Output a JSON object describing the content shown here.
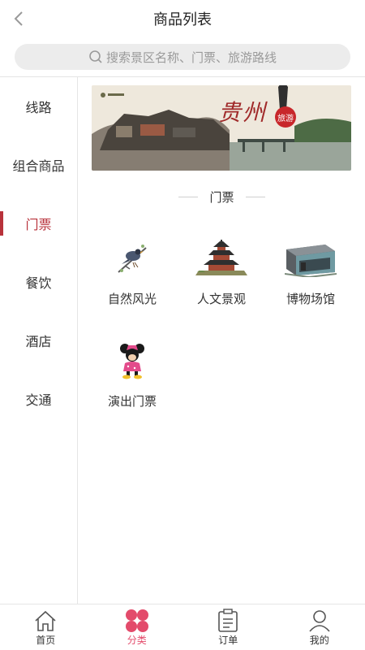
{
  "header": {
    "title": "商品列表"
  },
  "search": {
    "placeholder": "搜索景区名称、门票、旅游路线"
  },
  "sidebar": {
    "items": [
      {
        "label": "线路",
        "active": false
      },
      {
        "label": "组合商品",
        "active": false
      },
      {
        "label": "门票",
        "active": true
      },
      {
        "label": "餐饮",
        "active": false
      },
      {
        "label": "酒店",
        "active": false
      },
      {
        "label": "交通",
        "active": false
      }
    ]
  },
  "banner": {
    "title": "贵州",
    "badge": "旅游"
  },
  "section": {
    "title": "门票"
  },
  "categories": [
    {
      "label": "自然风光",
      "icon": "bird-branch-icon"
    },
    {
      "label": "人文景观",
      "icon": "pagoda-icon"
    },
    {
      "label": "博物场馆",
      "icon": "museum-icon"
    },
    {
      "label": "演出门票",
      "icon": "minnie-icon"
    }
  ],
  "tabbar": {
    "items": [
      {
        "label": "首页",
        "icon": "home-icon",
        "active": false
      },
      {
        "label": "分类",
        "icon": "category-icon",
        "active": true
      },
      {
        "label": "订单",
        "icon": "order-icon",
        "active": false
      },
      {
        "label": "我的",
        "icon": "user-icon",
        "active": false
      }
    ]
  },
  "colors": {
    "accent": "#b8323b",
    "tab_active": "#e34b6b",
    "search_bg": "#ececec"
  }
}
